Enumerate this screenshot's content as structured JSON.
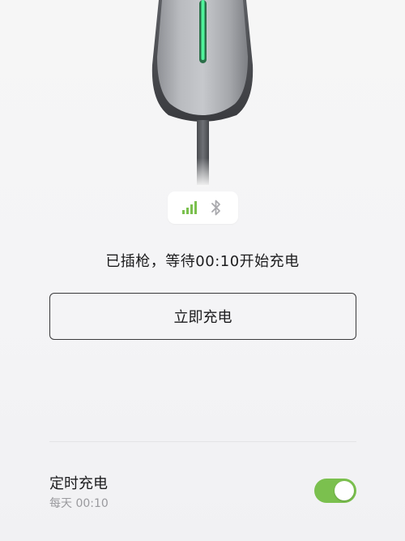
{
  "status": {
    "plug_message": "已插枪，等待00:10开始充电",
    "signal_icon": "signal-bars-icon",
    "bluetooth_icon": "bluetooth-icon"
  },
  "actions": {
    "charge_now_label": "立即充电"
  },
  "schedule": {
    "title": "定时充电",
    "subtitle": "每天 00:10",
    "enabled": true
  },
  "colors": {
    "accent_green": "#7bc04e",
    "led_green": "#3ddc84",
    "text_primary": "#1c1c1e",
    "text_secondary": "#9a9a9e"
  }
}
